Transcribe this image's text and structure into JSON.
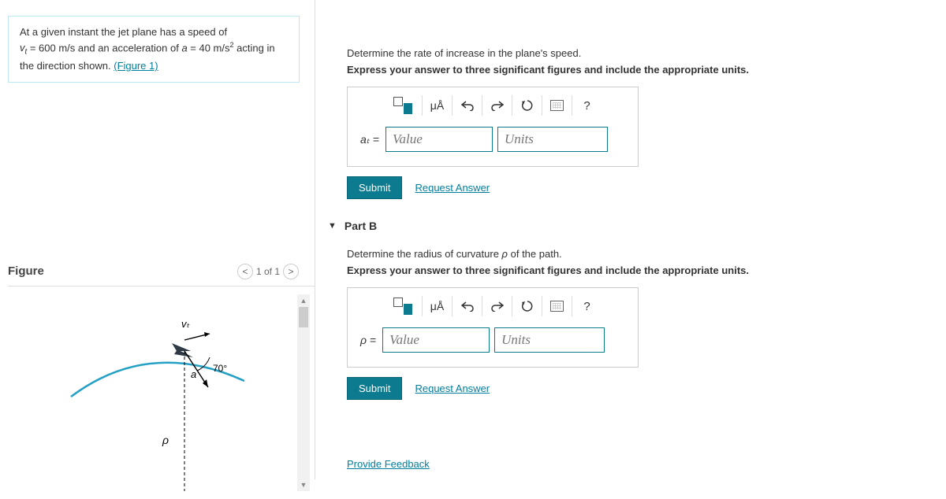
{
  "problem": {
    "text_1": "At a given instant the jet plane has a speed of",
    "text_2a": "v",
    "text_2b": " = 600 m/s and an acceleration of ",
    "text_2c": "a",
    "text_2d": " = 40 m/s",
    "text_2e": " acting in",
    "text_3": "the direction shown. ",
    "figure_link": "(Figure 1)"
  },
  "figure": {
    "title": "Figure",
    "pager": "1 of 1",
    "labels": {
      "vt": "vₜ",
      "a": "a",
      "rho": "ρ",
      "angle": "70°"
    }
  },
  "partA": {
    "prompt": "Determine the rate of increase in the plane's speed.",
    "instruction": "Express your answer to three significant figures and include the appropriate units.",
    "var": "aₜ =",
    "value_ph": "Value",
    "units_ph": "Units",
    "submit": "Submit",
    "request": "Request Answer"
  },
  "partB": {
    "header": "Part B",
    "prompt": "Determine the radius of curvature ρ of the path.",
    "instruction": "Express your answer to three significant figures and include the appropriate units.",
    "var": "ρ =",
    "value_ph": "Value",
    "units_ph": "Units",
    "submit": "Submit",
    "request": "Request Answer"
  },
  "toolbar": {
    "mua": "μÅ",
    "help": "?"
  },
  "feedback": "Provide Feedback"
}
